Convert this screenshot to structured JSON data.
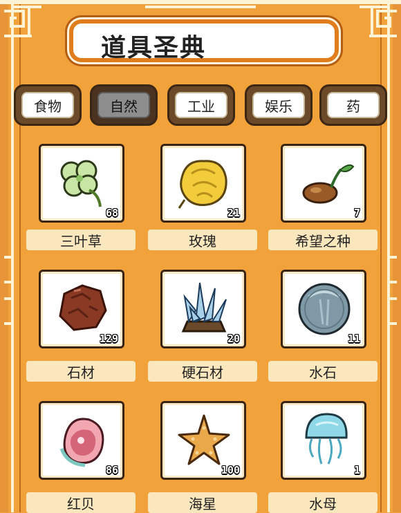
{
  "title": "道具圣典",
  "tabs": [
    {
      "label": "食物",
      "active": false
    },
    {
      "label": "自然",
      "active": true
    },
    {
      "label": "工业",
      "active": false
    },
    {
      "label": "娱乐",
      "active": false
    },
    {
      "label": "药",
      "active": false
    }
  ],
  "items": [
    {
      "name": "三叶草",
      "count": "68",
      "icon": "clover-icon"
    },
    {
      "name": "玫瑰",
      "count": "21",
      "icon": "rose-icon"
    },
    {
      "name": "希望之种",
      "count": "7",
      "icon": "seed-icon"
    },
    {
      "name": "石材",
      "count": "129",
      "icon": "stone-icon"
    },
    {
      "name": "硬石材",
      "count": "20",
      "icon": "crystal-stone-icon"
    },
    {
      "name": "水石",
      "count": "11",
      "icon": "water-stone-icon"
    },
    {
      "name": "红贝",
      "count": "86",
      "icon": "shell-icon"
    },
    {
      "name": "海星",
      "count": "100",
      "icon": "starfish-icon"
    },
    {
      "name": "水母",
      "count": "1",
      "icon": "jellyfish-icon"
    }
  ],
  "colors": {
    "background": "#f2a23a",
    "accent": "#e07d1c",
    "label_bg": "#fbe7bd"
  }
}
